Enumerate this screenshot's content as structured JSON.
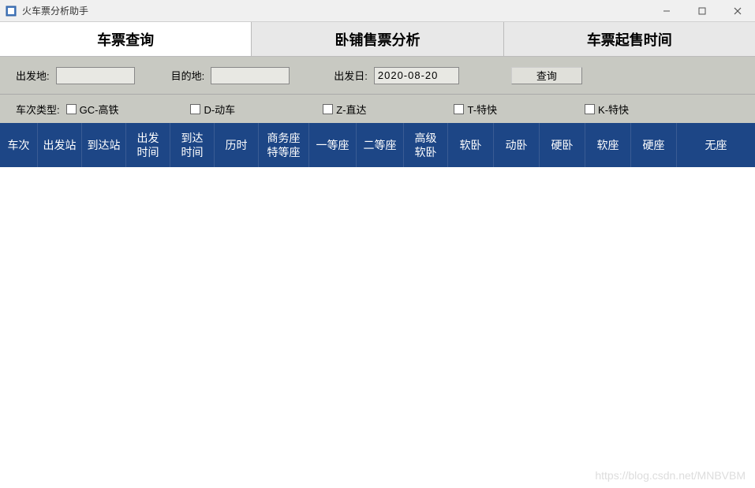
{
  "window": {
    "title": "火车票分析助手"
  },
  "tabs": [
    {
      "label": "车票查询",
      "active": true
    },
    {
      "label": "卧铺售票分析",
      "active": false
    },
    {
      "label": "车票起售时间",
      "active": false
    }
  ],
  "search": {
    "origin_label": "出发地:",
    "origin_value": "",
    "dest_label": "目的地:",
    "dest_value": "",
    "date_label": "出发日:",
    "date_value": "2020-08-20",
    "query_button": "查询"
  },
  "filters": {
    "type_label": "车次类型:",
    "options": [
      {
        "label": "GC-高铁",
        "checked": false
      },
      {
        "label": "D-动车",
        "checked": false
      },
      {
        "label": "Z-直达",
        "checked": false
      },
      {
        "label": "T-特快",
        "checked": false
      },
      {
        "label": "K-特快",
        "checked": false
      }
    ]
  },
  "table": {
    "columns": [
      "车次",
      "出发站",
      "到达站",
      "出发\n时间",
      "到达\n时间",
      "历时",
      "商务座\n特等座",
      "一等座",
      "二等座",
      "高级\n软卧",
      "软卧",
      "动卧",
      "硬卧",
      "软座",
      "硬座",
      "无座"
    ],
    "rows": []
  },
  "watermark": "https://blog.csdn.net/MNBVBM"
}
